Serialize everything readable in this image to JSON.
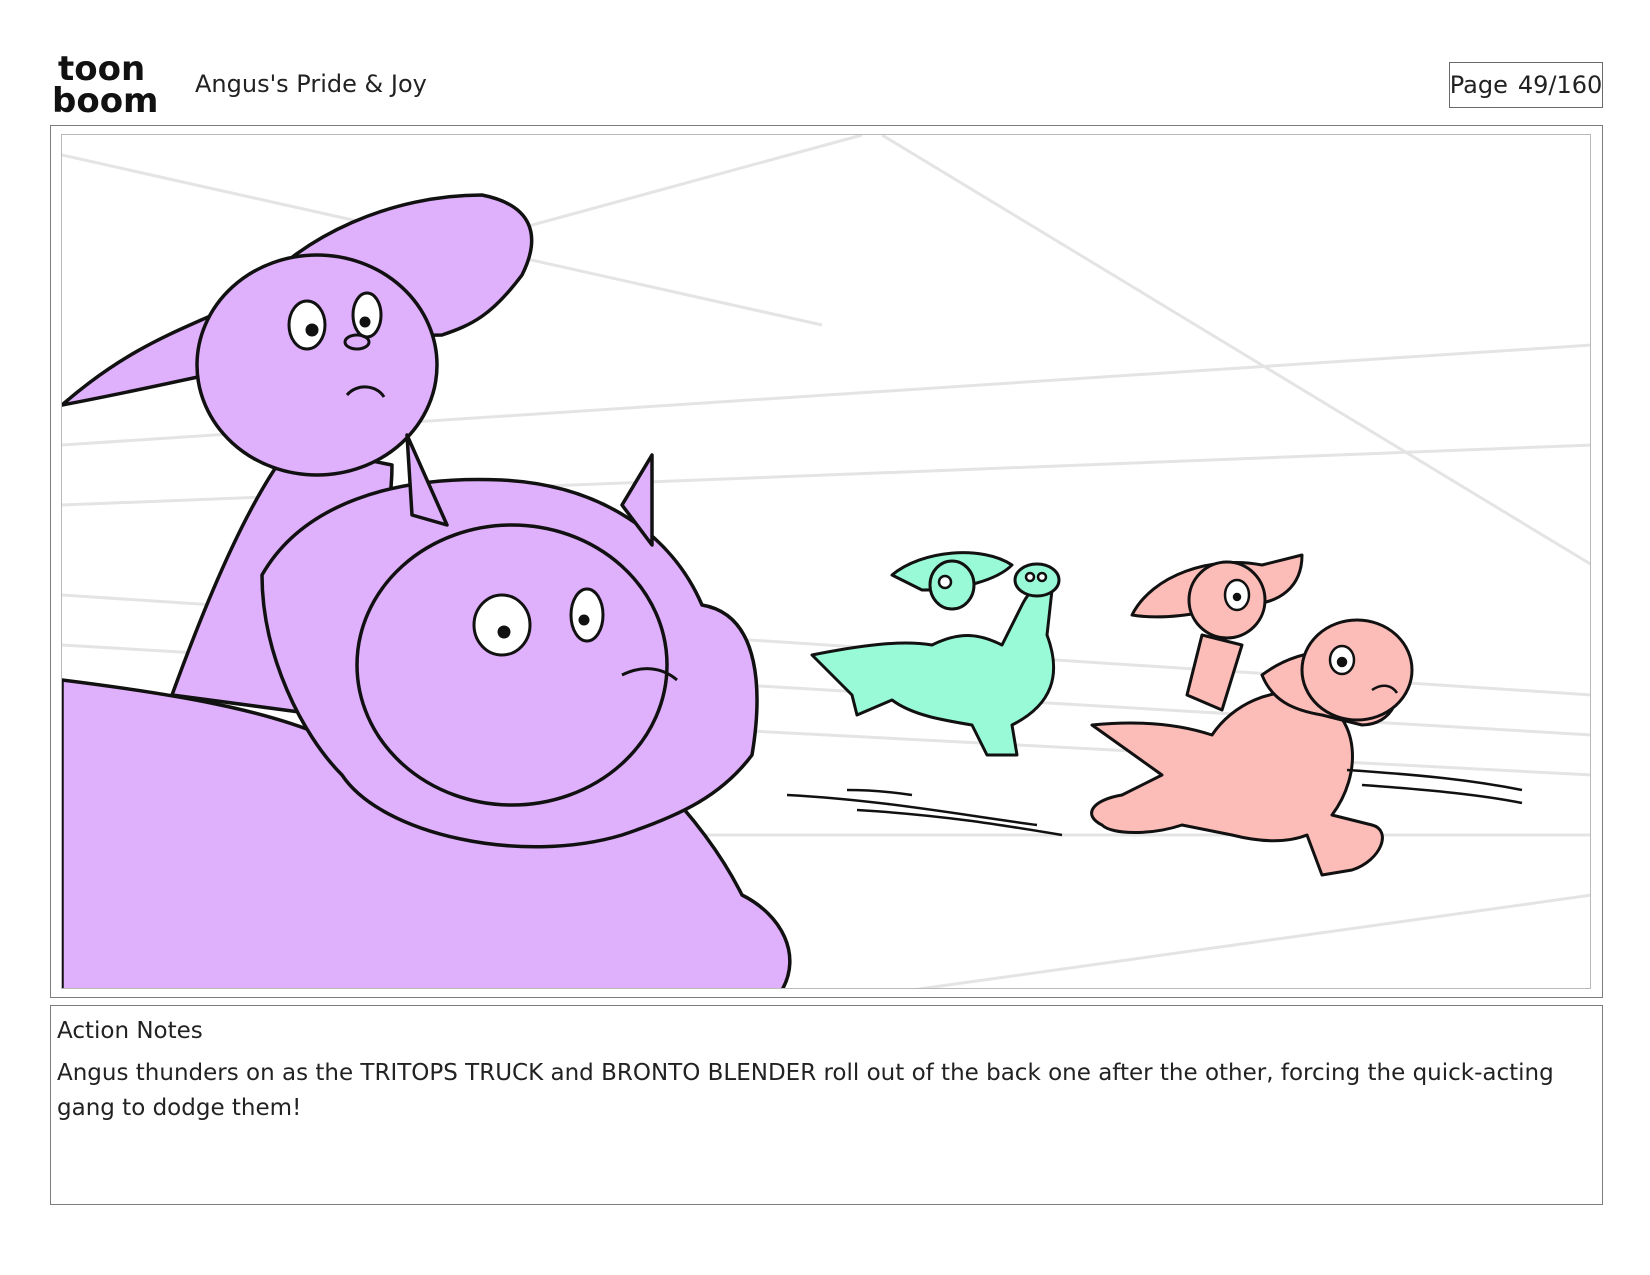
{
  "header": {
    "logo_top": "toon",
    "logo_bottom": "boom",
    "project_title": "Angus's Pride & Joy",
    "page_label": "Page",
    "page_number": "49/160"
  },
  "panel": {
    "colors": {
      "purple": "#dfb0fb",
      "green": "#99fad8",
      "pink": "#fcbcb7",
      "line": "#111111",
      "speed_lines": "#e4e4e4"
    }
  },
  "notes": {
    "label": "Action Notes",
    "text": "Angus thunders on as the TRITOPS TRUCK and BRONTO BLENDER roll out of the back one after the other, forcing the quick-acting gang to dodge them!"
  }
}
